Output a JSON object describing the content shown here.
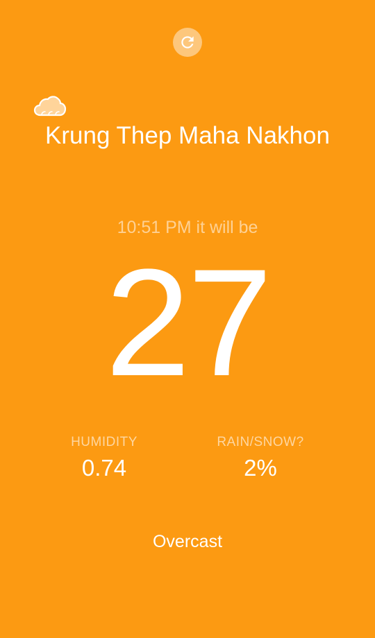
{
  "colors": {
    "background": "#FC9A12",
    "text": "#FFFFFF"
  },
  "header": {
    "refresh_icon": "refresh-icon"
  },
  "location": {
    "weather_icon": "cloud-icon",
    "city": "Krung Thep Maha Nakhon"
  },
  "forecast": {
    "time_caption": "10:51 PM it will be",
    "temperature": "27"
  },
  "stats": {
    "humidity_label": "HUMIDITY",
    "humidity_value": "0.74",
    "rain_label": "RAIN/SNOW?",
    "rain_value": "2%"
  },
  "summary": "Overcast"
}
